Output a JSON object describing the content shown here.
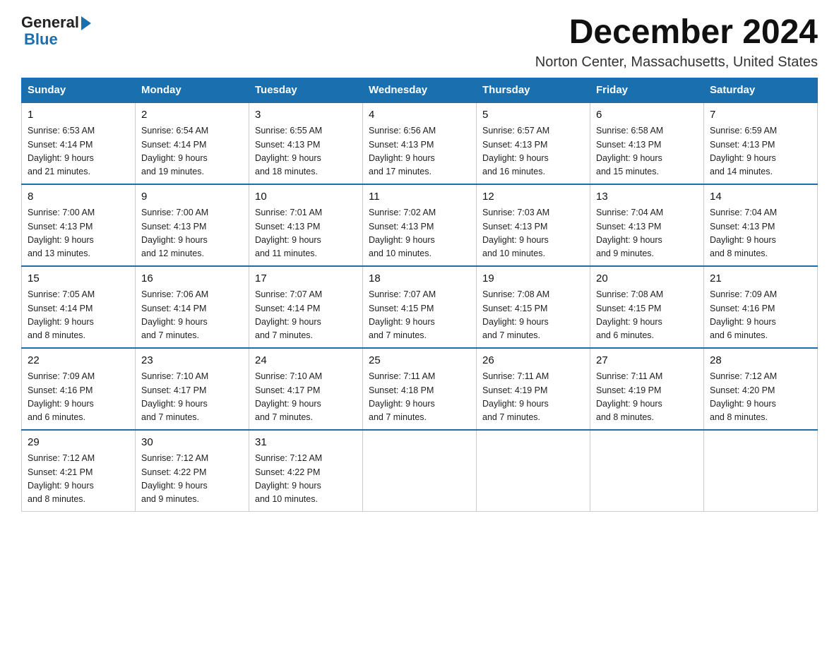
{
  "header": {
    "logo_general": "General",
    "logo_blue": "Blue",
    "title": "December 2024",
    "subtitle": "Norton Center, Massachusetts, United States"
  },
  "days_of_week": [
    "Sunday",
    "Monday",
    "Tuesday",
    "Wednesday",
    "Thursday",
    "Friday",
    "Saturday"
  ],
  "weeks": [
    [
      {
        "day": "1",
        "sunrise": "6:53 AM",
        "sunset": "4:14 PM",
        "daylight": "9 hours and 21 minutes."
      },
      {
        "day": "2",
        "sunrise": "6:54 AM",
        "sunset": "4:14 PM",
        "daylight": "9 hours and 19 minutes."
      },
      {
        "day": "3",
        "sunrise": "6:55 AM",
        "sunset": "4:13 PM",
        "daylight": "9 hours and 18 minutes."
      },
      {
        "day": "4",
        "sunrise": "6:56 AM",
        "sunset": "4:13 PM",
        "daylight": "9 hours and 17 minutes."
      },
      {
        "day": "5",
        "sunrise": "6:57 AM",
        "sunset": "4:13 PM",
        "daylight": "9 hours and 16 minutes."
      },
      {
        "day": "6",
        "sunrise": "6:58 AM",
        "sunset": "4:13 PM",
        "daylight": "9 hours and 15 minutes."
      },
      {
        "day": "7",
        "sunrise": "6:59 AM",
        "sunset": "4:13 PM",
        "daylight": "9 hours and 14 minutes."
      }
    ],
    [
      {
        "day": "8",
        "sunrise": "7:00 AM",
        "sunset": "4:13 PM",
        "daylight": "9 hours and 13 minutes."
      },
      {
        "day": "9",
        "sunrise": "7:00 AM",
        "sunset": "4:13 PM",
        "daylight": "9 hours and 12 minutes."
      },
      {
        "day": "10",
        "sunrise": "7:01 AM",
        "sunset": "4:13 PM",
        "daylight": "9 hours and 11 minutes."
      },
      {
        "day": "11",
        "sunrise": "7:02 AM",
        "sunset": "4:13 PM",
        "daylight": "9 hours and 10 minutes."
      },
      {
        "day": "12",
        "sunrise": "7:03 AM",
        "sunset": "4:13 PM",
        "daylight": "9 hours and 10 minutes."
      },
      {
        "day": "13",
        "sunrise": "7:04 AM",
        "sunset": "4:13 PM",
        "daylight": "9 hours and 9 minutes."
      },
      {
        "day": "14",
        "sunrise": "7:04 AM",
        "sunset": "4:13 PM",
        "daylight": "9 hours and 8 minutes."
      }
    ],
    [
      {
        "day": "15",
        "sunrise": "7:05 AM",
        "sunset": "4:14 PM",
        "daylight": "9 hours and 8 minutes."
      },
      {
        "day": "16",
        "sunrise": "7:06 AM",
        "sunset": "4:14 PM",
        "daylight": "9 hours and 7 minutes."
      },
      {
        "day": "17",
        "sunrise": "7:07 AM",
        "sunset": "4:14 PM",
        "daylight": "9 hours and 7 minutes."
      },
      {
        "day": "18",
        "sunrise": "7:07 AM",
        "sunset": "4:15 PM",
        "daylight": "9 hours and 7 minutes."
      },
      {
        "day": "19",
        "sunrise": "7:08 AM",
        "sunset": "4:15 PM",
        "daylight": "9 hours and 7 minutes."
      },
      {
        "day": "20",
        "sunrise": "7:08 AM",
        "sunset": "4:15 PM",
        "daylight": "9 hours and 6 minutes."
      },
      {
        "day": "21",
        "sunrise": "7:09 AM",
        "sunset": "4:16 PM",
        "daylight": "9 hours and 6 minutes."
      }
    ],
    [
      {
        "day": "22",
        "sunrise": "7:09 AM",
        "sunset": "4:16 PM",
        "daylight": "9 hours and 6 minutes."
      },
      {
        "day": "23",
        "sunrise": "7:10 AM",
        "sunset": "4:17 PM",
        "daylight": "9 hours and 7 minutes."
      },
      {
        "day": "24",
        "sunrise": "7:10 AM",
        "sunset": "4:17 PM",
        "daylight": "9 hours and 7 minutes."
      },
      {
        "day": "25",
        "sunrise": "7:11 AM",
        "sunset": "4:18 PM",
        "daylight": "9 hours and 7 minutes."
      },
      {
        "day": "26",
        "sunrise": "7:11 AM",
        "sunset": "4:19 PM",
        "daylight": "9 hours and 7 minutes."
      },
      {
        "day": "27",
        "sunrise": "7:11 AM",
        "sunset": "4:19 PM",
        "daylight": "9 hours and 8 minutes."
      },
      {
        "day": "28",
        "sunrise": "7:12 AM",
        "sunset": "4:20 PM",
        "daylight": "9 hours and 8 minutes."
      }
    ],
    [
      {
        "day": "29",
        "sunrise": "7:12 AM",
        "sunset": "4:21 PM",
        "daylight": "9 hours and 8 minutes."
      },
      {
        "day": "30",
        "sunrise": "7:12 AM",
        "sunset": "4:22 PM",
        "daylight": "9 hours and 9 minutes."
      },
      {
        "day": "31",
        "sunrise": "7:12 AM",
        "sunset": "4:22 PM",
        "daylight": "9 hours and 10 minutes."
      },
      null,
      null,
      null,
      null
    ]
  ]
}
